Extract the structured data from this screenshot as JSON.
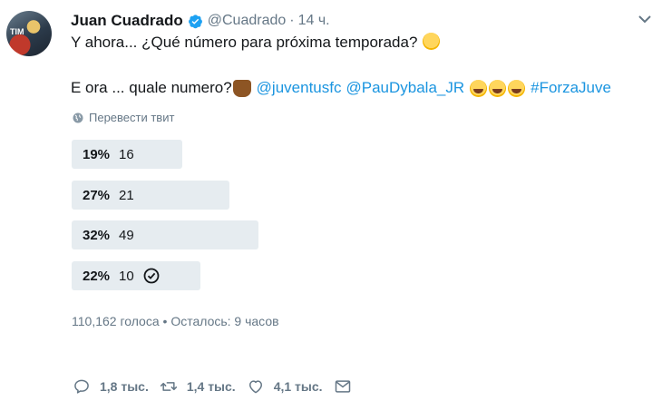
{
  "author": {
    "name": "Juan Cuadrado",
    "handle": "@Cuadrado",
    "separator": "·",
    "time": "14 ч.",
    "avatar_tag": "TIM"
  },
  "tweet": {
    "line1": "Y ahora... ¿Qué número para próxima temporada?",
    "line2_text": "E ora ... quale numero?",
    "mention1": "@juventusfc",
    "mention2": "@PauDybala_JR",
    "hashtag": "#ForzaJuve"
  },
  "translate_label": "Перевести твит",
  "poll": {
    "options": [
      {
        "percent": "19%",
        "label": "16",
        "fraction": 0.19,
        "selected": false
      },
      {
        "percent": "27%",
        "label": "21",
        "fraction": 0.27,
        "selected": false
      },
      {
        "percent": "32%",
        "label": "49",
        "fraction": 0.32,
        "selected": false
      },
      {
        "percent": "22%",
        "label": "10",
        "fraction": 0.22,
        "selected": true
      }
    ],
    "meta": "110,162 голоса • Осталось: 9 часов"
  },
  "actions": {
    "replies": "1,8 тыс.",
    "retweets": "1,4 тыс.",
    "likes": "4,1 тыс."
  },
  "colors": {
    "link": "#1b95e0",
    "verified": "#1da1f2",
    "poll_bar": "#e6ecf0",
    "muted": "#657786"
  }
}
